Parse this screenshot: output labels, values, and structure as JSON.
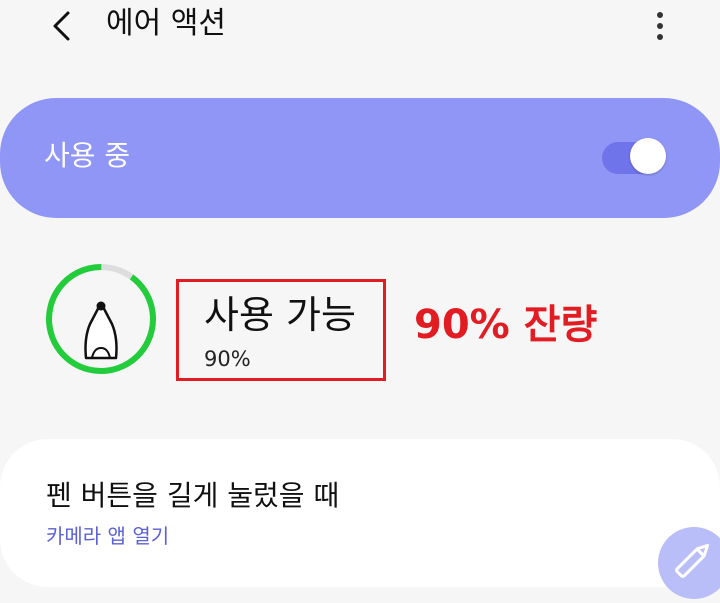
{
  "header": {
    "title": "에어 액션",
    "back_icon": "arrow-back-icon",
    "more_icon": "more-vertical-icon"
  },
  "master_toggle": {
    "label": "사용 중",
    "state": "on",
    "card_color": "#9096f6",
    "track_color": "#6f74ea"
  },
  "pen_status": {
    "title": "사용 가능",
    "percent_text": "90%",
    "battery_level": 0.9,
    "ring_color": "#22cc3a",
    "ring_track_color": "#dddddd",
    "icon": "s-pen-icon"
  },
  "annotation": {
    "text": "90% 잔량",
    "color": "#e11c22"
  },
  "pen_button_option": {
    "title": "펜 버튼을 길게 눌렀을 때",
    "subtitle": "카메라 앱 열기",
    "subtitle_color": "#5c62d6"
  },
  "floating_button": {
    "icon": "pen-edit-icon",
    "color": "#b9bdf8"
  }
}
